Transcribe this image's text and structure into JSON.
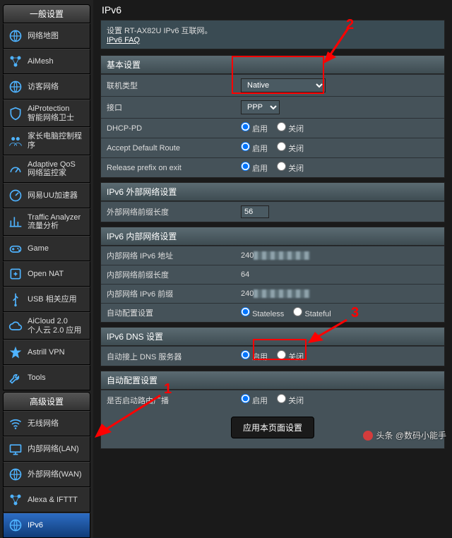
{
  "sidebar": {
    "group_general": "一般设置",
    "group_advanced": "高级设置",
    "items_general": [
      {
        "label": "网络地图"
      },
      {
        "label": "AiMesh"
      },
      {
        "label": "访客网络"
      },
      {
        "label": "AiProtection\n智能网络卫士"
      },
      {
        "label": "家长电脑控制程序"
      },
      {
        "label": "Adaptive QoS\n网络监控家"
      },
      {
        "label": "网易UU加速器"
      },
      {
        "label": "Traffic Analyzer\n流量分析"
      },
      {
        "label": "Game"
      },
      {
        "label": "Open NAT"
      },
      {
        "label": "USB 相关应用"
      },
      {
        "label": "AiCloud 2.0\n个人云 2.0 应用"
      },
      {
        "label": "Astrill VPN"
      },
      {
        "label": "Tools"
      }
    ],
    "items_advanced": [
      {
        "label": "无线网络"
      },
      {
        "label": "内部网络(LAN)"
      },
      {
        "label": "外部网络(WAN)"
      },
      {
        "label": "Alexa & IFTTT"
      },
      {
        "label": "IPv6"
      }
    ],
    "active": "IPv6"
  },
  "page": {
    "title": "IPv6",
    "desc_line": "设置 RT-AX82U IPv6 互联网。",
    "faq_link": "IPv6  FAQ"
  },
  "sections": {
    "basic": {
      "title": "基本设置",
      "conn_type_label": "联机类型",
      "conn_type_value": "Native",
      "interface_label": "接口",
      "interface_value": "PPP",
      "dhcp_pd_label": "DHCP-PD",
      "dhcp_pd_value": "启用",
      "accept_route_label": "Accept Default Route",
      "accept_route_value": "启用",
      "release_prefix_label": "Release prefix on exit",
      "release_prefix_value": "启用",
      "opt_enable": "启用",
      "opt_disable": "关闭"
    },
    "wan": {
      "title": "IPv6 外部网络设置",
      "prefix_len_label": "外部网络前缀长度",
      "prefix_len_value": "56"
    },
    "lan": {
      "title": "IPv6 内部网络设置",
      "addr_label": "内部网络 IPv6 地址",
      "addr_value": "240",
      "len_label": "内部网络前缀长度",
      "len_value": "64",
      "prefix_label": "内部网络 IPv6 前缀",
      "prefix_value": "240",
      "auto_label": "自动配置设置",
      "auto_stateless": "Stateless",
      "auto_stateful": "Stateful",
      "auto_value": "Stateless"
    },
    "dns": {
      "title": "IPv6 DNS 设置",
      "auto_dns_label": "自动接上 DNS 服务器",
      "auto_dns_value": "启用"
    },
    "auto": {
      "title": "自动配置设置",
      "ra_label": "是否启动路由广播",
      "ra_value": "启用"
    }
  },
  "apply_button": "应用本页面设置",
  "annotations": {
    "n1": "1",
    "n2": "2",
    "n3": "3"
  },
  "watermark": "头条 @数码小能手"
}
